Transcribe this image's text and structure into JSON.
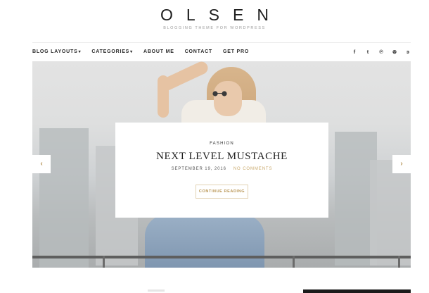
{
  "site": {
    "title": "OLSEN",
    "tagline": "BLOGGING THEME FOR WORDPRESS"
  },
  "nav": {
    "items": [
      {
        "label": "BLOG LAYOUTS",
        "caret": "▾"
      },
      {
        "label": "CATEGORIES",
        "caret": "▾"
      },
      {
        "label": "ABOUT ME",
        "caret": ""
      },
      {
        "label": "CONTACT",
        "caret": ""
      },
      {
        "label": "GET PRO",
        "caret": ""
      }
    ],
    "social": [
      {
        "icon": "facebook-icon",
        "glyph": "f"
      },
      {
        "icon": "twitter-icon",
        "glyph": "t"
      },
      {
        "icon": "pinterest-icon",
        "glyph": "℗"
      },
      {
        "icon": "dribbble-icon",
        "glyph": "⊛"
      },
      {
        "icon": "rss-icon",
        "glyph": "ͽ"
      }
    ]
  },
  "slider": {
    "category": "FASHION",
    "title": "NEXT LEVEL MUSTACHE",
    "date": "SEPTEMBER 19, 2016",
    "comments": "NO COMMENTS",
    "cta": "CONTINUE READING",
    "prev": "‹",
    "next": "›"
  },
  "colors": {
    "accent": "#c9a96b",
    "text": "#222222"
  }
}
